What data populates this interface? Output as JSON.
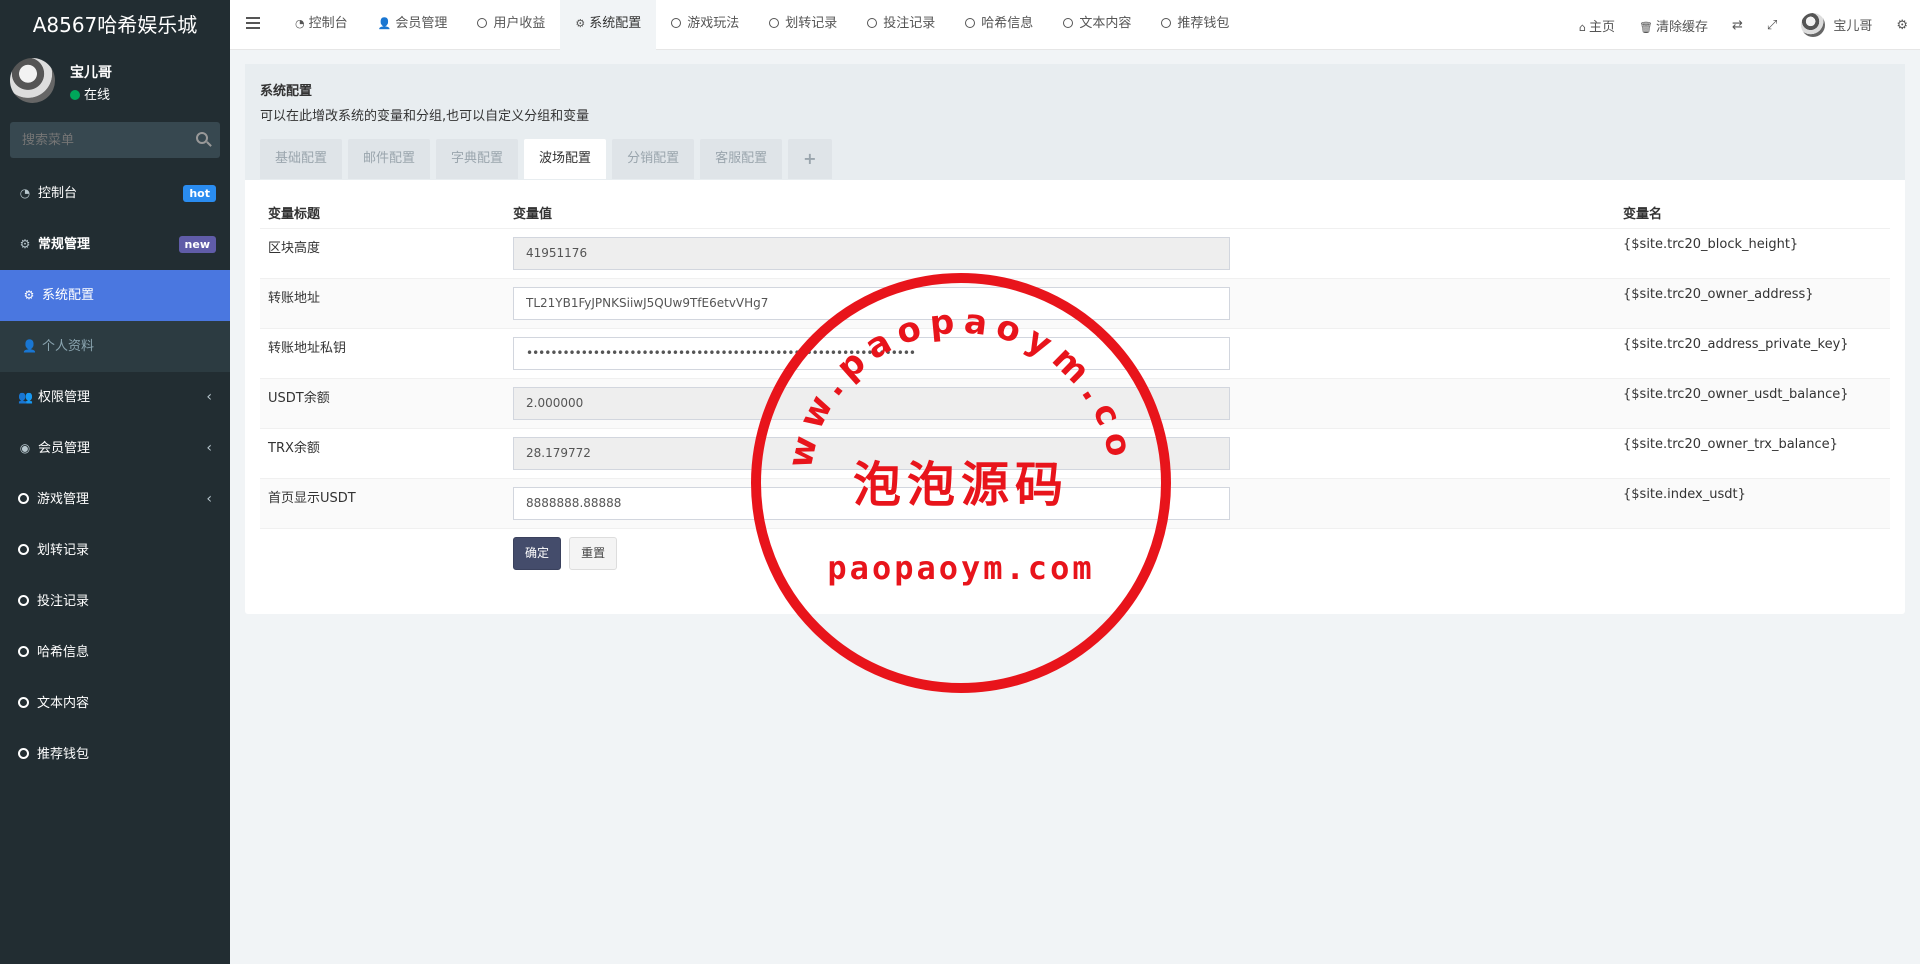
{
  "sidebar": {
    "logo": "A8567哈希娱乐城",
    "user": {
      "name": "宝儿哥",
      "status": "在线"
    },
    "search_placeholder": "搜索菜单",
    "items": [
      {
        "label": "控制台",
        "badge": "hot"
      },
      {
        "label": "常规管理",
        "badge": "new"
      },
      {
        "label": "系统配置"
      },
      {
        "label": "个人资料"
      },
      {
        "label": "权限管理"
      },
      {
        "label": "会员管理"
      },
      {
        "label": "游戏管理"
      },
      {
        "label": "划转记录"
      },
      {
        "label": "投注记录"
      },
      {
        "label": "哈希信息"
      },
      {
        "label": "文本内容"
      },
      {
        "label": "推荐钱包"
      }
    ]
  },
  "topbar": {
    "tabs": [
      "控制台",
      "会员管理",
      "用户收益",
      "系统配置",
      "游戏玩法",
      "划转记录",
      "投注记录",
      "哈希信息",
      "文本内容",
      "推荐钱包"
    ],
    "right": {
      "home": "主页",
      "clear_cache": "清除缓存",
      "user": "宝儿哥"
    }
  },
  "panel": {
    "title": "系统配置",
    "description": "可以在此增改系统的变量和分组,也可以自定义分组和变量",
    "tabs": [
      "基础配置",
      "邮件配置",
      "字典配置",
      "波场配置",
      "分销配置",
      "客服配置",
      "+"
    ],
    "active_tab": "波场配置"
  },
  "table": {
    "headers": [
      "变量标题",
      "变量值",
      "变量名"
    ],
    "rows": [
      {
        "title": "区块高度",
        "value": "41951176",
        "name": "{$site.trc20_block_height}",
        "readonly": true
      },
      {
        "title": "转账地址",
        "value": "TL21YB1FyJPNKSiiwJ5QUw9TfE6etvVHg7",
        "name": "{$site.trc20_owner_address}",
        "readonly": false
      },
      {
        "title": "转账地址私钥",
        "value": "••••••••••••••••••••••••••••••••••••••••••••••••••••••••••••••••",
        "name": "{$site.trc20_address_private_key}",
        "readonly": false
      },
      {
        "title": "USDT余额",
        "value": "2.000000",
        "name": "{$site.trc20_owner_usdt_balance}",
        "readonly": true
      },
      {
        "title": "TRX余额",
        "value": "28.179772",
        "name": "{$site.trc20_owner_trx_balance}",
        "readonly": true
      },
      {
        "title": "首页显示USDT",
        "value": "8888888.88888",
        "name": "{$site.index_usdt}",
        "readonly": false
      }
    ],
    "buttons": {
      "submit": "确定",
      "reset": "重置"
    }
  },
  "watermark": {
    "arc_text": "www.paopaoym.com",
    "center_text": "泡泡源码",
    "bottom_text": "paopaoym.com",
    "color": "#e8141b"
  }
}
